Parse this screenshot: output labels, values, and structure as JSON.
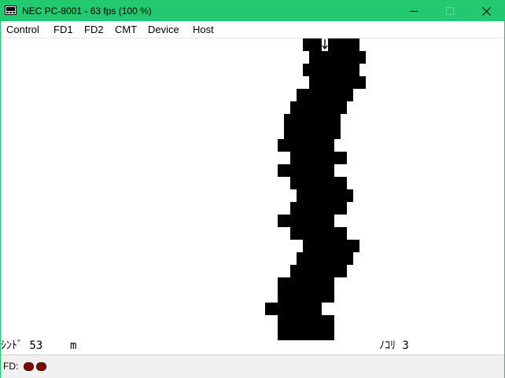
{
  "window": {
    "title": "NEC PC-8001 - 63 fps (100 %)"
  },
  "menu": {
    "items": [
      "Control",
      "FD1",
      "FD2",
      "CMT",
      "Device",
      "Host"
    ]
  },
  "screen": {
    "left_label": "ｼﾝﾄﾞ 53",
    "unit_label": "m",
    "right_label": "ﾉｺﾘ 3",
    "road_color": "#000000",
    "player_icon": "down-arrow-car-icon"
  },
  "status": {
    "fd_label": "FD:",
    "led_color": "#7a0b0b"
  }
}
